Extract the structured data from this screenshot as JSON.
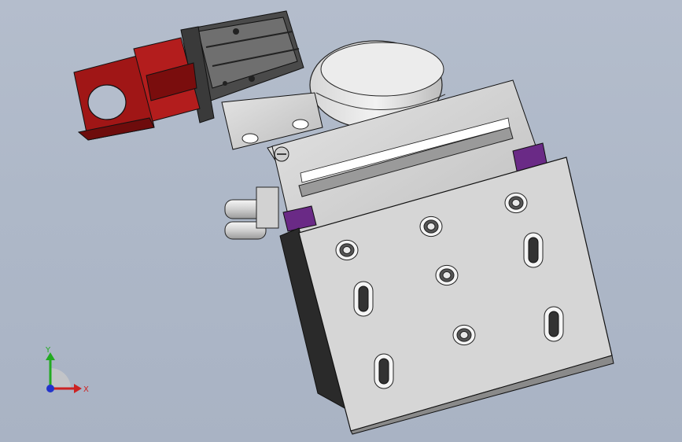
{
  "viewport": {
    "background_top": "#b4bdcc",
    "background_bottom": "#a9b3c4"
  },
  "model": {
    "gripper_color": "#a01616",
    "accent_color": "#6a2a86",
    "metal_color": "#c9c9c9",
    "cylinder_color": "#5e5e5e"
  },
  "triad": {
    "y_label": "Y",
    "x_label": "X",
    "y_color": "#22aa22",
    "x_color": "#cc2222",
    "z_color": "#2233cc"
  }
}
